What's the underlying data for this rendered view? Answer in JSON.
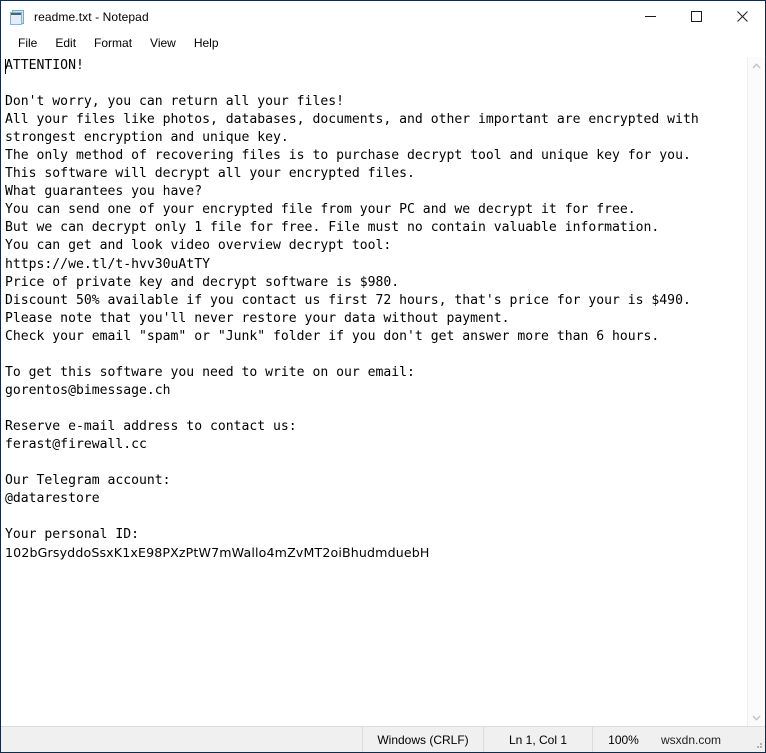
{
  "window": {
    "title": "readme.txt - Notepad",
    "icon": "notepad-icon",
    "controls": {
      "minimize": "minimize-icon",
      "maximize": "maximize-icon",
      "close": "close-icon"
    }
  },
  "menu": {
    "items": [
      {
        "label": "File"
      },
      {
        "label": "Edit"
      },
      {
        "label": "Format"
      },
      {
        "label": "View"
      },
      {
        "label": "Help"
      }
    ]
  },
  "document": {
    "lines": [
      "ATTENTION!",
      "",
      "Don't worry, you can return all your files!",
      "All your files like photos, databases, documents, and other important are encrypted with",
      "strongest encryption and unique key.",
      "The only method of recovering files is to purchase decrypt tool and unique key for you.",
      "This software will decrypt all your encrypted files.",
      "What guarantees you have?",
      "You can send one of your encrypted file from your PC and we decrypt it for free.",
      "But we can decrypt only 1 file for free. File must no contain valuable information.",
      "You can get and look video overview decrypt tool:",
      "https://we.tl/t-hvv30uAtTY",
      "Price of private key and decrypt software is $980.",
      "Discount 50% available if you contact us first 72 hours, that's price for your is $490.",
      "Please note that you'll never restore your data without payment.",
      "Check your email \"spam\" or \"Junk\" folder if you don't get answer more than 6 hours.",
      "",
      "To get this software you need to write on our email:",
      "gorentos@bimessage.ch",
      "",
      "Reserve e-mail address to contact us:",
      "ferast@firewall.cc",
      "",
      "Our Telegram account:",
      "@datarestore",
      "",
      "Your personal ID:",
      "102bGrsyddoSsxK1xE98PXzPtW7mWallo4mZvMT2oiBhudmduebH"
    ],
    "proportional_line_indexes": [
      27
    ]
  },
  "statusbar": {
    "line_ending": "Windows (CRLF)",
    "cursor_position": "Ln 1, Col 1",
    "zoom": "100%",
    "watermark": "wsxdn.com"
  },
  "scrollbar": {
    "up_arrow": "chevron-up-icon",
    "down_arrow": "chevron-down-icon"
  },
  "colors": {
    "window_border": "#0f2b46",
    "status_background": "#f0f0f0",
    "text": "#000000",
    "editor_background": "#ffffff"
  }
}
